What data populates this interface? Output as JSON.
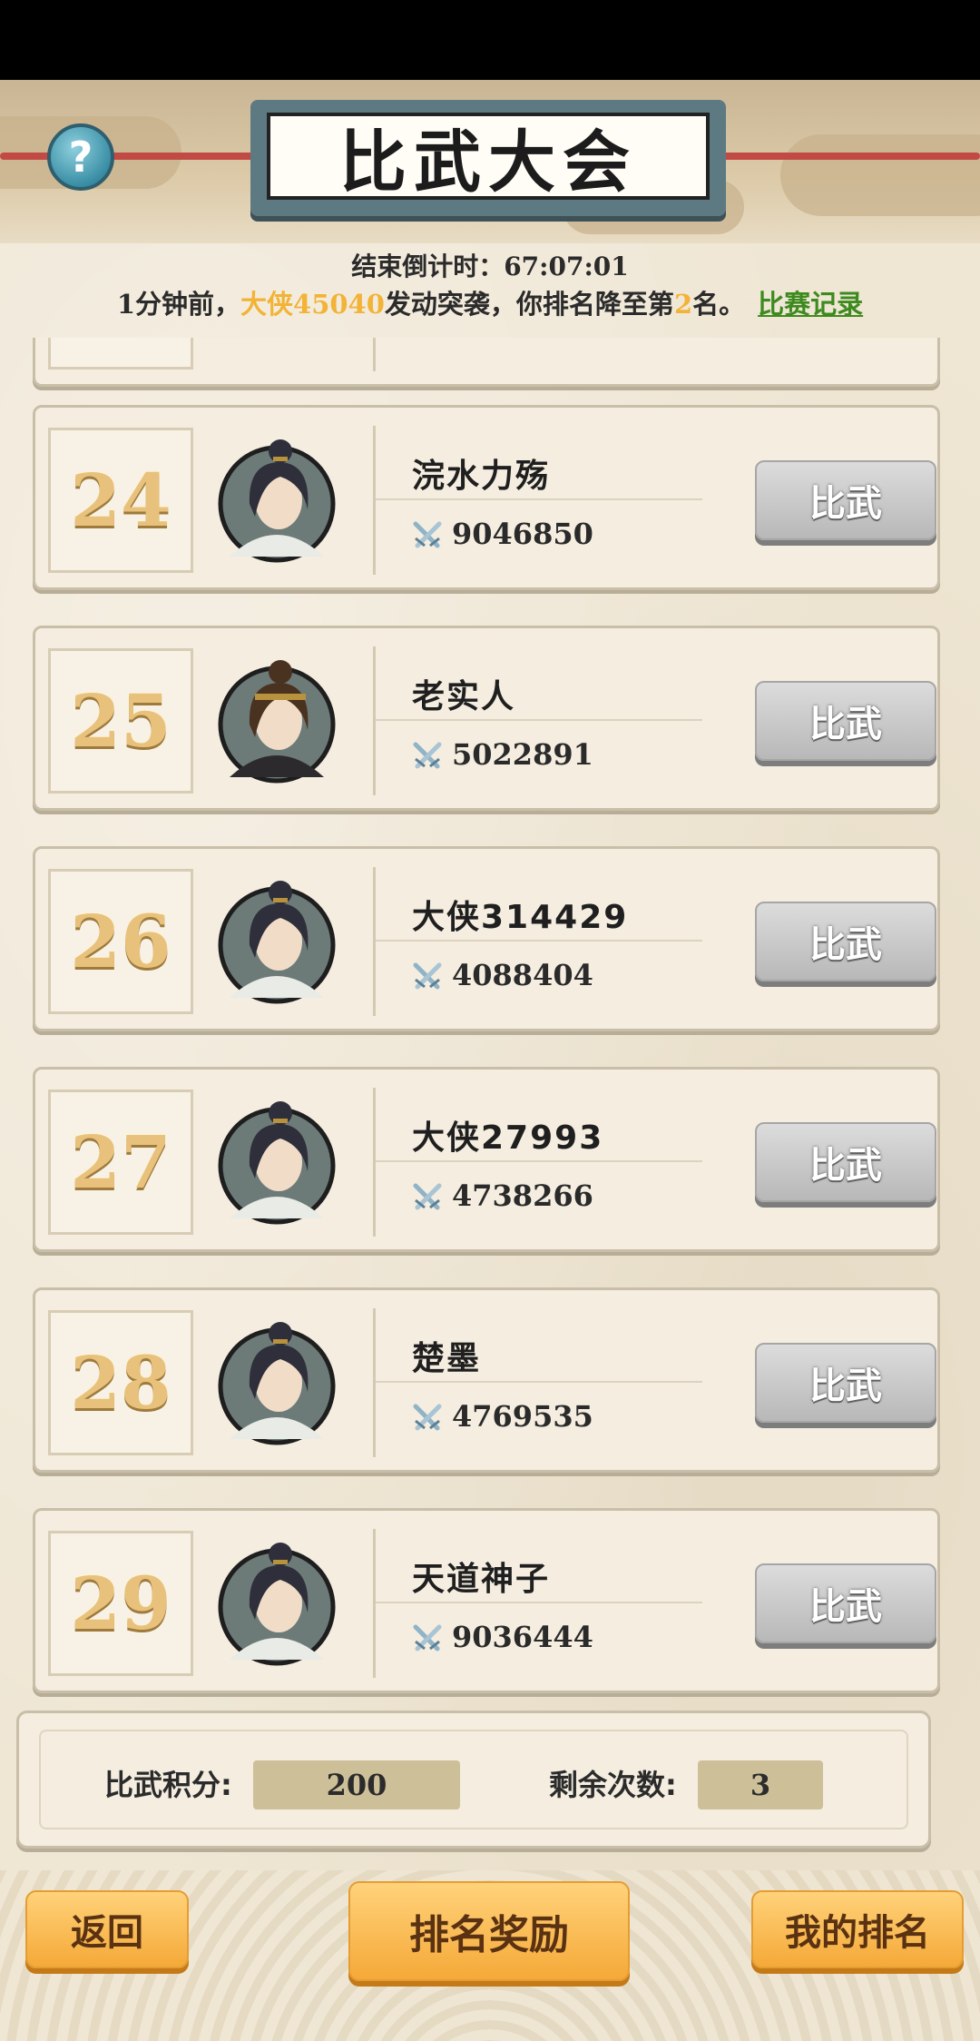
{
  "header": {
    "title": "比武大会",
    "help_icon": "?",
    "countdown": "结束倒计时：67:07:01",
    "notice": {
      "part1": "1分钟前，",
      "attacker": "大侠45040",
      "part2": "发动突袭，你排名降至第",
      "rank": "2",
      "part3": "名。",
      "record_link": "比赛记录"
    }
  },
  "opponents": [
    {
      "rank": "24",
      "name": "浣水力殇",
      "power": "9046850",
      "button": "比武",
      "avatar": "male-topknot-white"
    },
    {
      "rank": "25",
      "name": "老实人",
      "power": "5022891",
      "button": "比武",
      "avatar": "male-headband-dark"
    },
    {
      "rank": "26",
      "name": "大侠314429",
      "power": "4088404",
      "button": "比武",
      "avatar": "male-topknot-white"
    },
    {
      "rank": "27",
      "name": "大侠27993",
      "power": "4738266",
      "button": "比武",
      "avatar": "male-topknot-white"
    },
    {
      "rank": "28",
      "name": "楚墨",
      "power": "4769535",
      "button": "比武",
      "avatar": "male-topknot-white"
    },
    {
      "rank": "29",
      "name": "天道神子",
      "power": "9036444",
      "button": "比武",
      "avatar": "male-topknot-white"
    }
  ],
  "stats": {
    "score_label": "比武积分:",
    "score_value": "200",
    "remaining_label": "剩余次数:",
    "remaining_value": "3"
  },
  "buttons": {
    "back": "返回",
    "rank_rewards": "排名奖励",
    "my_rank": "我的排名"
  },
  "colors": {
    "highlight": "#f2b336",
    "link": "#3d8a1f",
    "accent_button": "#f5a938"
  }
}
